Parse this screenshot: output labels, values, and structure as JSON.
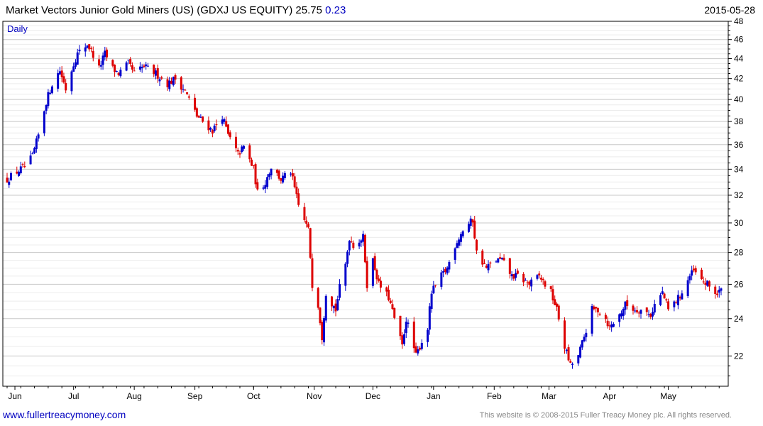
{
  "header": {
    "title": "Market Vectors Junior Gold Miners (US) (GDXJ US EQUITY) 25.75",
    "change": "0.23",
    "date": "2015-05-28"
  },
  "footer": {
    "site_link": "www.fullertreacymoney.com",
    "copyright": "This website is © 2008-2015 Fuller Treacy Money plc. All rights reserved."
  },
  "colors": {
    "up": "#0000cc",
    "down": "#dd0000",
    "grid": "#c8c8c8",
    "axis": "#000000"
  },
  "chart_data": {
    "type": "candlestick",
    "title": "Market Vectors Junior Gold Miners (US) (GDXJ US EQUITY)",
    "period_label": "Daily",
    "y_scale": "log",
    "ylim": [
      20.5,
      48
    ],
    "y_ticks": [
      22,
      24,
      26,
      28,
      30,
      32,
      34,
      36,
      38,
      40,
      42,
      44,
      46,
      48
    ],
    "x_ticks": [
      "Jun",
      "Jul",
      "Aug",
      "Sep",
      "Oct",
      "Nov",
      "Dec",
      "Jan",
      "Feb",
      "Mar",
      "Apr",
      "May"
    ],
    "x_range": [
      "2014-05-28",
      "2015-05-28"
    ],
    "last_close": 25.75,
    "change": 0.23,
    "close_path": [
      [
        "2014-05-28",
        33.2
      ],
      [
        "2014-06-02",
        33.8
      ],
      [
        "2014-06-06",
        34.2
      ],
      [
        "2014-06-10",
        35.0
      ],
      [
        "2014-06-13",
        36.8
      ],
      [
        "2014-06-17",
        39.8
      ],
      [
        "2014-06-20",
        41.5
      ],
      [
        "2014-06-24",
        42.8
      ],
      [
        "2014-06-27",
        41.0
      ],
      [
        "2014-07-01",
        43.5
      ],
      [
        "2014-07-03",
        44.5
      ],
      [
        "2014-07-08",
        45.5
      ],
      [
        "2014-07-10",
        44.8
      ],
      [
        "2014-07-14",
        43.0
      ],
      [
        "2014-07-17",
        44.5
      ],
      [
        "2014-07-21",
        43.0
      ],
      [
        "2014-07-24",
        42.5
      ],
      [
        "2014-07-29",
        43.5
      ],
      [
        "2014-08-01",
        42.5
      ],
      [
        "2014-08-06",
        43.2
      ],
      [
        "2014-08-12",
        42.5
      ],
      [
        "2014-08-18",
        41.5
      ],
      [
        "2014-08-22",
        42.0
      ],
      [
        "2014-08-27",
        40.8
      ],
      [
        "2014-09-02",
        38.5
      ],
      [
        "2014-09-05",
        38.0
      ],
      [
        "2014-09-10",
        37.2
      ],
      [
        "2014-09-15",
        38.5
      ],
      [
        "2014-09-18",
        36.8
      ],
      [
        "2014-09-23",
        35.2
      ],
      [
        "2014-09-26",
        35.8
      ],
      [
        "2014-10-01",
        34.0
      ],
      [
        "2014-10-03",
        32.2
      ],
      [
        "2014-10-07",
        33.0
      ],
      [
        "2014-10-10",
        34.2
      ],
      [
        "2014-10-15",
        33.2
      ],
      [
        "2014-10-20",
        33.8
      ],
      [
        "2014-10-24",
        31.2
      ],
      [
        "2014-10-29",
        29.5
      ],
      [
        "2014-10-31",
        26.0
      ],
      [
        "2014-11-03",
        24.8
      ],
      [
        "2014-11-05",
        23.0
      ],
      [
        "2014-11-07",
        25.5
      ],
      [
        "2014-11-12",
        24.5
      ],
      [
        "2014-11-14",
        25.8
      ],
      [
        "2014-11-17",
        27.2
      ],
      [
        "2014-11-19",
        29.0
      ],
      [
        "2014-11-21",
        28.5
      ],
      [
        "2014-11-26",
        29.0
      ],
      [
        "2014-11-28",
        26.0
      ],
      [
        "2014-12-01",
        27.5
      ],
      [
        "2014-12-04",
        26.0
      ],
      [
        "2014-12-09",
        25.2
      ],
      [
        "2014-12-12",
        24.0
      ],
      [
        "2014-12-16",
        22.5
      ],
      [
        "2014-12-18",
        24.0
      ],
      [
        "2014-12-23",
        22.0
      ],
      [
        "2014-12-29",
        23.5
      ],
      [
        "2014-12-31",
        25.5
      ],
      [
        "2015-01-05",
        26.5
      ],
      [
        "2015-01-08",
        27.0
      ],
      [
        "2015-01-12",
        28.5
      ],
      [
        "2015-01-16",
        29.5
      ],
      [
        "2015-01-21",
        30.2
      ],
      [
        "2015-01-23",
        28.0
      ],
      [
        "2015-01-28",
        27.0
      ],
      [
        "2015-02-02",
        27.5
      ],
      [
        "2015-02-05",
        27.5
      ],
      [
        "2015-02-10",
        26.5
      ],
      [
        "2015-02-13",
        26.5
      ],
      [
        "2015-02-19",
        26.0
      ],
      [
        "2015-02-24",
        26.5
      ],
      [
        "2015-02-27",
        26.0
      ],
      [
        "2015-03-02",
        25.5
      ],
      [
        "2015-03-05",
        24.5
      ],
      [
        "2015-03-09",
        22.5
      ],
      [
        "2015-03-12",
        21.5
      ],
      [
        "2015-03-16",
        22.0
      ],
      [
        "2015-03-19",
        23.0
      ],
      [
        "2015-03-23",
        24.5
      ],
      [
        "2015-03-26",
        24.5
      ],
      [
        "2015-03-30",
        24.0
      ],
      [
        "2015-04-01",
        23.5
      ],
      [
        "2015-04-06",
        24.2
      ],
      [
        "2015-04-09",
        24.8
      ],
      [
        "2015-04-14",
        24.5
      ],
      [
        "2015-04-17",
        24.5
      ],
      [
        "2015-04-22",
        24.2
      ],
      [
        "2015-04-24",
        24.8
      ],
      [
        "2015-04-28",
        25.5
      ],
      [
        "2015-05-01",
        24.5
      ],
      [
        "2015-05-05",
        25.0
      ],
      [
        "2015-05-08",
        25.5
      ],
      [
        "2015-05-12",
        26.5
      ],
      [
        "2015-05-14",
        26.8
      ],
      [
        "2015-05-18",
        26.2
      ],
      [
        "2015-05-21",
        26.0
      ],
      [
        "2015-05-26",
        25.4
      ],
      [
        "2015-05-28",
        25.75
      ]
    ]
  }
}
